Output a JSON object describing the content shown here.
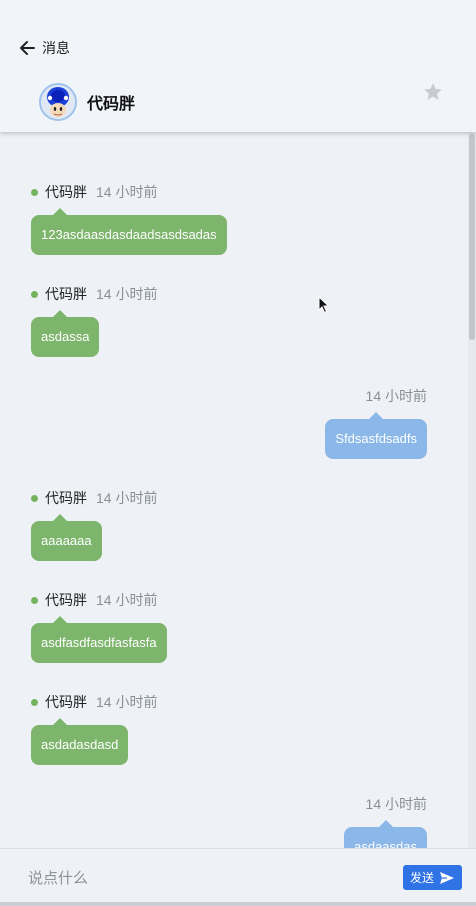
{
  "header": {
    "back_label": "消息",
    "contact_name": "代码胖",
    "star_icon": "star-icon",
    "avatar_icon": "toad-avatar"
  },
  "messages": [
    {
      "direction": "in",
      "sender": "代码胖",
      "time": "14 小时前",
      "text": "123asdaasdasdaadsasdsadas"
    },
    {
      "direction": "in",
      "sender": "代码胖",
      "time": "14 小时前",
      "text": "asdassa"
    },
    {
      "direction": "out",
      "sender": "",
      "time": "14 小时前",
      "text": "Sfdsasfdsadfs"
    },
    {
      "direction": "in",
      "sender": "代码胖",
      "time": "14 小时前",
      "text": "aaaaaaa"
    },
    {
      "direction": "in",
      "sender": "代码胖",
      "time": "14 小时前",
      "text": "asdfasdfasdfasfasfa"
    },
    {
      "direction": "in",
      "sender": "代码胖",
      "time": "14 小时前",
      "text": "asdadasdasd"
    },
    {
      "direction": "out",
      "sender": "",
      "time": "14 小时前",
      "text": "asdaasdas"
    }
  ],
  "composer": {
    "placeholder": "说点什么",
    "send_label": "发送"
  },
  "colors": {
    "incoming_bubble": "#7db56c",
    "outgoing_bubble": "#8bb8e8",
    "online_dot": "#76b35f",
    "send_button": "#2f73e6"
  }
}
